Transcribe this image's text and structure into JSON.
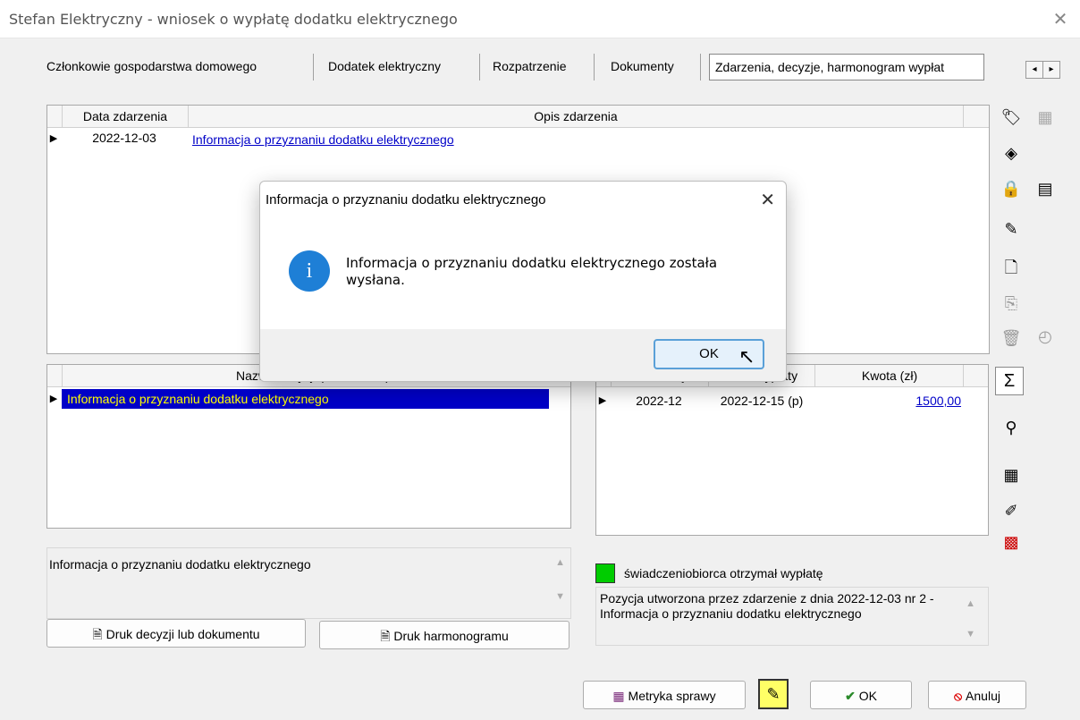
{
  "window": {
    "title": "Stefan Elektryczny - wniosek o wypłatę dodatku elektrycznego"
  },
  "tabs": [
    "Członkowie gospodarstwa domowego",
    "Dodatek elektryczny",
    "Rozpatrzenie",
    "Dokumenty",
    "Zdarzenia, decyzje, harmonogram wypłat"
  ],
  "events": {
    "columns": [
      "Data zdarzenia",
      "Opis zdarzenia"
    ],
    "rows": [
      {
        "date": "2022-12-03",
        "description": "Informacja o przyznaniu dodatku elektrycznego"
      }
    ]
  },
  "decisions": {
    "column": "Nazwa decyzji (dokumentu)",
    "rows": [
      {
        "name": "Informacja o przyznaniu dodatku elektrycznego"
      }
    ]
  },
  "schedule": {
    "columns": [
      "Za miesiąc",
      "Data wypłaty",
      "Kwota (zł)"
    ],
    "rows": [
      {
        "month": "2022-12",
        "date": "2022-12-15 (p)",
        "amount": "1500,00"
      }
    ]
  },
  "decision_note": "Informacja o przyznaniu dodatku elektrycznego",
  "legend": {
    "label": "świadczeniobiorca otrzymał wypłatę",
    "color": "#00cc00"
  },
  "schedule_note": "Pozycja utworzona przez zdarzenie z dnia 2022-12-03 nr 2 - Informacja o przyznaniu dodatku elektrycznego",
  "buttons": {
    "print_decision": "Druk decyzji lub dokumentu",
    "print_schedule": "Druk harmonogramu",
    "metrics": "Metryka sprawy",
    "ok": "OK",
    "cancel": "Anuluj"
  },
  "dialog": {
    "title": "Informacja o przyznaniu dodatku elektrycznego",
    "message": "Informacja o przyznaniu dodatku elektrycznego została wysłana.",
    "ok": "OK",
    "icon": "info-icon"
  },
  "colors": {
    "selection": "#0000c8",
    "selection_text": "#ffff00",
    "link": "#0000c8",
    "info": "#1e7fd6",
    "highlight_button": "#ffff66"
  }
}
